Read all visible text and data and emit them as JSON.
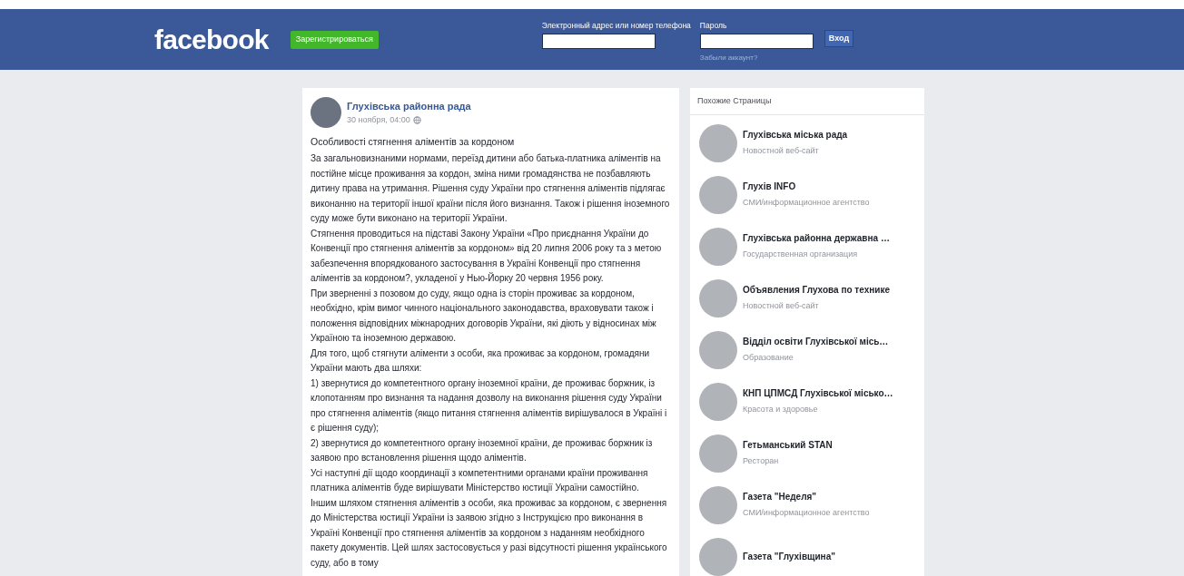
{
  "header": {
    "logo": "facebook",
    "signup_button": "Зарегистрироваться",
    "email_label": "Электронный адрес или номер телефона",
    "password_label": "Пароль",
    "login_button": "Вход",
    "forgot_link": "Забыли аккаунт?"
  },
  "post": {
    "author": "Глухівська районна рада",
    "time": "30 ноября, 04:00",
    "title": "Особливості стягнення аліментів за кордоном",
    "paragraphs": [
      "За загальновизнаними нормами, переїзд дитини або батька-платника аліментів на постійне місце проживання за кордон, зміна ними громадянства не позбавляють дитину права на утримання. Рішення суду України про стягнення аліментів підлягає виконанню на території іншої країни після його визнання. Також і рішення іноземного суду може бути виконано на території України.",
      "Стягнення проводиться на підставі Закону України «Про приєднання України до Конвенції про стягнення аліментів за кордоном» від 20 липня 2006 року та з метою забезпечення впорядкованого застосування в Україні Конвенції про стягнення аліментів за кордоном?, укладеної у Нью-Йорку 20 червня 1956 року.",
      "При зверненні з позовом до суду, якщо одна із сторін проживає за кордоном, необхідно, крім вимог чинного національного законодавства, враховувати також і положення відповідних міжнародних договорів України, які діють у відносинах між Україною та іноземною державою.",
      "Для того, щоб стягнути аліменти з особи, яка проживає за кордоном, громадяни України мають два шляхи:",
      "1) звернутися до компетентного органу іноземної країни, де проживає боржник, із клопотанням про визнання та надання дозволу на виконання рішення суду України про стягнення аліментів (якщо питання стягнення аліментів вирішувалося в Україні і є рішення суду);",
      "2) звернутися до компетентного органу іноземної країни, де проживає боржник із заявою про встановлення рішення щодо аліментів.",
      "Усі наступні дії щодо координації з компетентними органами країни проживання платника аліментів буде вирішувати Міністерство юстиції України самостійно.",
      "Іншим шляхом стягнення аліментів з особи, яка проживає за кордоном, є звернення до Міністерства юстиції України із заявою згідно з Інструкцією про виконання в Україні Конвенції про стягнення аліментів за кордоном з наданням необхідного пакету документів. Цей шлях застосовується у разі відсутності рішення українського суду, або в тому"
    ]
  },
  "related_pages": {
    "title": "Похожие Страницы",
    "items": [
      {
        "name": "Глухівська міська рада",
        "category": "Новостной веб-сайт"
      },
      {
        "name": "Глухів INFO",
        "category": "СМИ/информационное агентство"
      },
      {
        "name": "Глухівська районна державна …",
        "category": "Государственная организация"
      },
      {
        "name": "Объявления Глухова по технике",
        "category": "Новостной веб-сайт"
      },
      {
        "name": "Відділ освіти Глухівської місь…",
        "category": "Образование"
      },
      {
        "name": "КНП ЦПМСД Глухівської місько…",
        "category": "Красота и здоровье"
      },
      {
        "name": "Гетьманський STAN",
        "category": "Ресторан"
      },
      {
        "name": "Газета \"Неделя\"",
        "category": "СМИ/информационное агентство"
      },
      {
        "name": "Газета \"Глухівщина\""
      }
    ]
  }
}
